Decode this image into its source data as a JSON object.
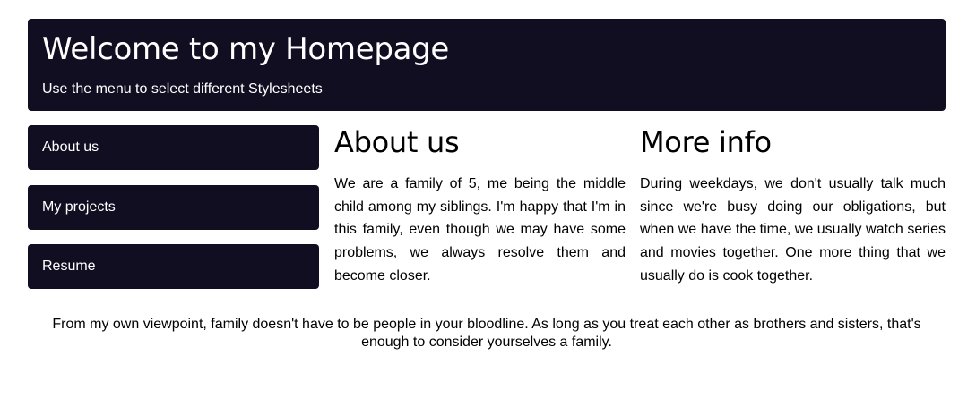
{
  "header": {
    "title": "Welcome to my Homepage",
    "subtitle": "Use the menu to select different Stylesheets"
  },
  "menu": {
    "items": [
      {
        "label": "About us"
      },
      {
        "label": "My projects"
      },
      {
        "label": "Resume"
      }
    ]
  },
  "about": {
    "heading": "About us",
    "text": "We are a family of 5, me being the middle child among my siblings. I'm happy that I'm in this family, even though we may have some problems, we always resolve them and become closer."
  },
  "more_info": {
    "heading": "More info",
    "text": "During weekdays, we don't usually talk much since we're busy doing our obligations, but when we have the time, we usually watch series and movies together. One more thing that we usually do is cook together."
  },
  "footer": {
    "text": "From my own viewpoint, family doesn't have to be people in your bloodline. As long as you treat each other as brothers and sisters, that's enough to consider yourselves a family."
  },
  "colors": {
    "panel_background": "#110e22",
    "panel_text": "#ffffff",
    "page_background": "#ffffff",
    "body_text": "#000000"
  }
}
